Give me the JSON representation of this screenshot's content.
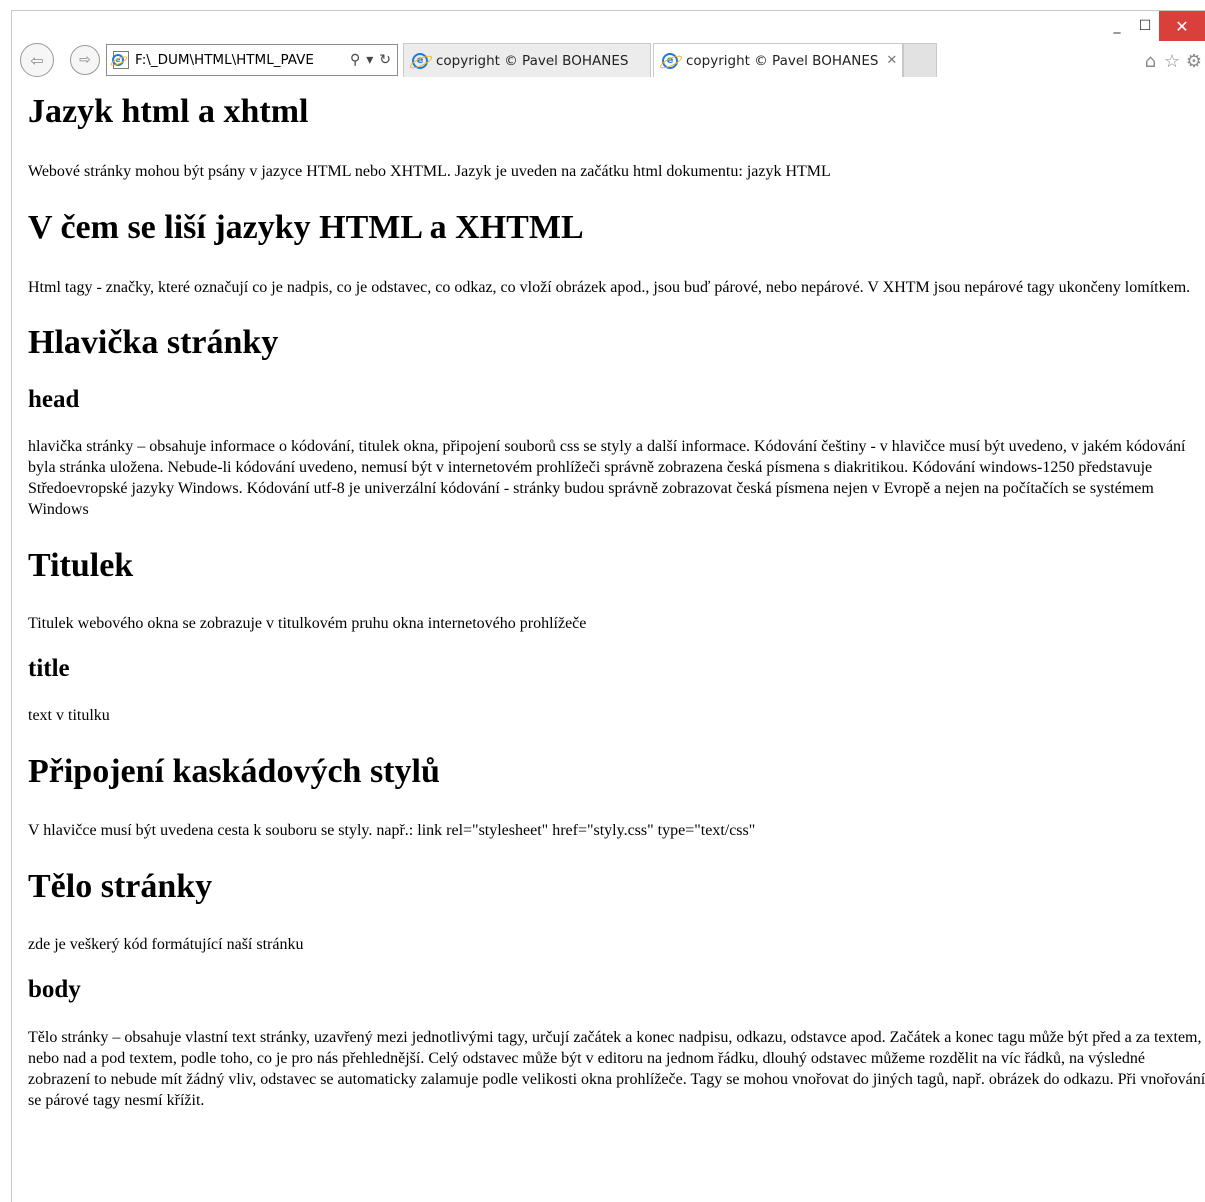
{
  "window": {
    "minimize_glyph": "_",
    "maximize_glyph": "☐",
    "close_glyph": "✕"
  },
  "nav": {
    "back_glyph": "⇦",
    "forward_glyph": "⇨",
    "address": "F:\\_DUM\\HTML\\HTML_PAVE",
    "search_glyph": "⚲",
    "dropdown_glyph": "▾",
    "refresh_glyph": "↻",
    "ie_glyph": "e"
  },
  "tabs": [
    {
      "label": "copyright © Pavel BOHANES"
    },
    {
      "label": "copyright © Pavel BOHANES",
      "close_glyph": "✕"
    }
  ],
  "toolbar": {
    "home_glyph": "⌂",
    "favorites_glyph": "☆",
    "tools_glyph": "⚙"
  },
  "content": {
    "h_jazyk": "Jazyk html a xhtml",
    "p_jazyk": "Webové stránky mohou být psány v jazyce HTML nebo XHTML. Jazyk je uveden na začátku html dokumentu: jazyk HTML",
    "h_lisi": "V čem se liší jazyky HTML a XHTML",
    "p_lisi": "Html tagy - značky, které označují co je nadpis, co je odstavec, co odkaz, co vloží obrázek apod., jsou buď párové, nebo nepárové. V XHTM jsou nepárové tagy ukončeny lomítkem.",
    "h_hlavicka": "Hlavička stránky",
    "h_head": "head",
    "p_head": "hlavička stránky – obsahuje informace o kódování, titulek okna, připojení souborů css se styly a další informace. Kódování češtiny - v hlavičce musí být uvedeno, v jakém kódování byla stránka uložena. Nebude-li kódování uvedeno, nemusí být v internetovém prohlížeči správně zobrazena česká písmena s diakritikou. Kódování windows-1250 představuje Středoevropské jazyky Windows. Kódování utf-8 je univerzální kódování - stránky budou správně zobrazovat česká písmena nejen v Evropě a nejen na počítačích se systémem Windows",
    "h_titulek": "Titulek",
    "p_titulek": "Titulek webového okna se zobrazuje v titulkovém pruhu okna internetového prohlížeče",
    "h_title": "title",
    "p_title": "text v titulku",
    "h_styly": "Připojení kaskádových stylů",
    "p_styly": "V hlavičce musí být uvedena cesta k souboru se styly. např.: link rel=\"stylesheet\" href=\"styly.css\" type=\"text/css\"",
    "h_telo": "Tělo stránky",
    "p_telo": "zde je veškerý kód formátující naší stránku",
    "h_body": "body",
    "p_body": "Tělo stránky – obsahuje vlastní text stránky, uzavřený mezi jednotlivými tagy, určují začátek a konec nadpisu, odkazu, odstavce apod. Začátek a konec tagu může být před a za textem, nebo nad a pod textem, podle toho, co je pro nás přehlednější. Celý odstavec může být v editoru na jednom řádku, dlouhý odstavec můžeme rozdělit na víc řádků, na výsledné zobrazení to nebude mít žádný vliv, odstavec se automaticky zalamuje podle velikosti okna prohlížeče. Tagy se mohou vnořovat do jiných tagů, např. obrázek do odkazu. Při vnořování se párové tagy nesmí křížit."
  }
}
